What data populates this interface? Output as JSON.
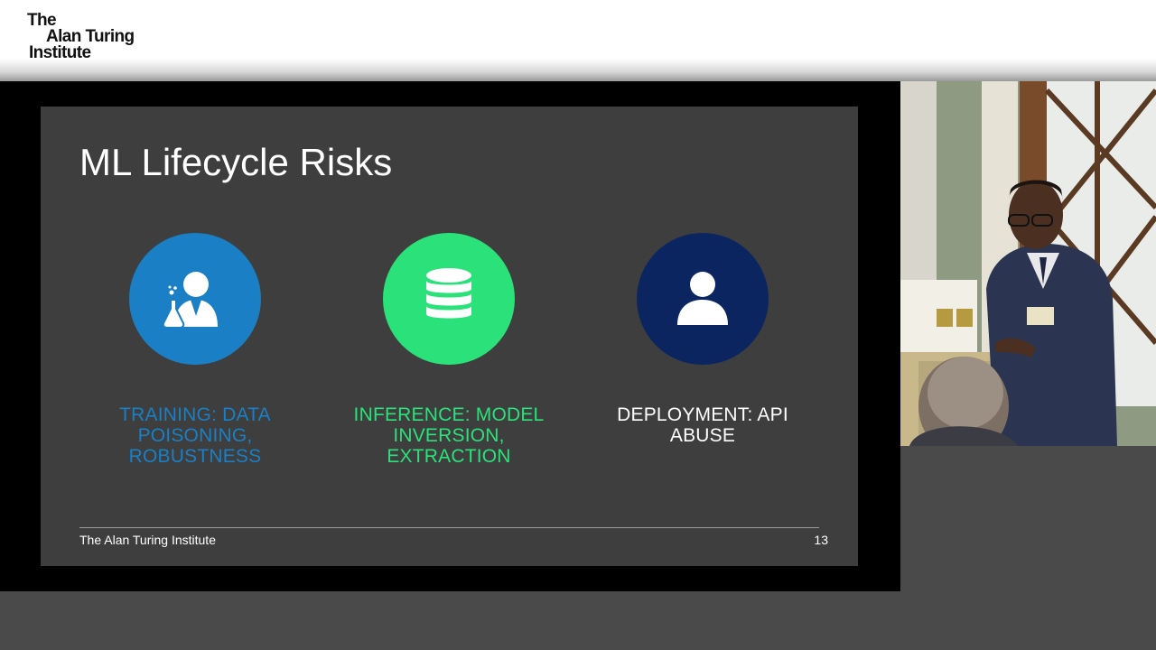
{
  "header": {
    "logo_lines": [
      "The",
      "Alan Turing",
      "Institute"
    ]
  },
  "slide": {
    "title": "ML Lifecycle Risks",
    "risks": [
      {
        "label": "TRAINING: DATA POISONING, ROBUSTNESS",
        "color": "#1a7fc4",
        "icon": "scientist-icon",
        "circle_color": "#1a7fc4"
      },
      {
        "label": "INFERENCE: MODEL INVERSION, EXTRACTION",
        "color": "#2be27a",
        "icon": "database-icon",
        "circle_color": "#2be27a"
      },
      {
        "label": "DEPLOYMENT: API ABUSE",
        "color": "#ffffff",
        "icon": "user-icon",
        "circle_color": "#0b2561"
      }
    ],
    "footer_org": "The Alan Turing Institute",
    "page_number": "13"
  },
  "colors": {
    "slide_bg": "#3e3e3e",
    "stage_bg": "#000000",
    "page_bg": "#4a4a4a"
  }
}
